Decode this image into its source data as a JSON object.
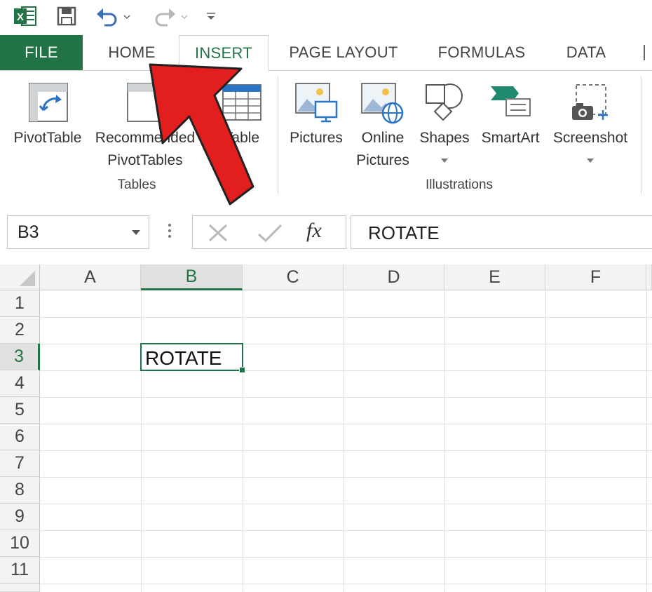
{
  "qat": {
    "icons": [
      "excel-logo-icon",
      "save-icon",
      "undo-icon",
      "redo-icon",
      "customize-qat-icon"
    ]
  },
  "tabs": [
    {
      "label": "FILE"
    },
    {
      "label": "HOME"
    },
    {
      "label": "INSERT"
    },
    {
      "label": "PAGE LAYOUT"
    },
    {
      "label": "FORMULAS"
    },
    {
      "label": "DATA"
    }
  ],
  "ribbon": {
    "tables_group": {
      "label": "Tables",
      "buttons": [
        {
          "line1": "PivotTable",
          "line2": ""
        },
        {
          "line1": "Recommended",
          "line2": "PivotTables"
        },
        {
          "line1": "Table",
          "line2": ""
        }
      ]
    },
    "illustrations_group": {
      "label": "Illustrations",
      "buttons": [
        {
          "line1": "Pictures",
          "line2": ""
        },
        {
          "line1": "Online",
          "line2": "Pictures"
        },
        {
          "line1": "Shapes",
          "line2": ""
        },
        {
          "line1": "SmartArt",
          "line2": ""
        },
        {
          "line1": "Screenshot",
          "line2": ""
        }
      ]
    }
  },
  "formula_bar": {
    "name_box": "B3",
    "formula": "ROTATE",
    "fx_label": "fx"
  },
  "sheet": {
    "columns": [
      "A",
      "B",
      "C",
      "D",
      "E",
      "F"
    ],
    "rows": [
      "1",
      "2",
      "3",
      "4",
      "5",
      "6",
      "7",
      "8",
      "9",
      "10",
      "11"
    ],
    "active_cell": "B3",
    "cell_b3": "ROTATE"
  },
  "annotation": {
    "arrow_color": "#e31e1e",
    "points_to": "INSERT tab"
  },
  "colors": {
    "excel_green": "#217346",
    "header_bg": "#f3f3f3"
  }
}
